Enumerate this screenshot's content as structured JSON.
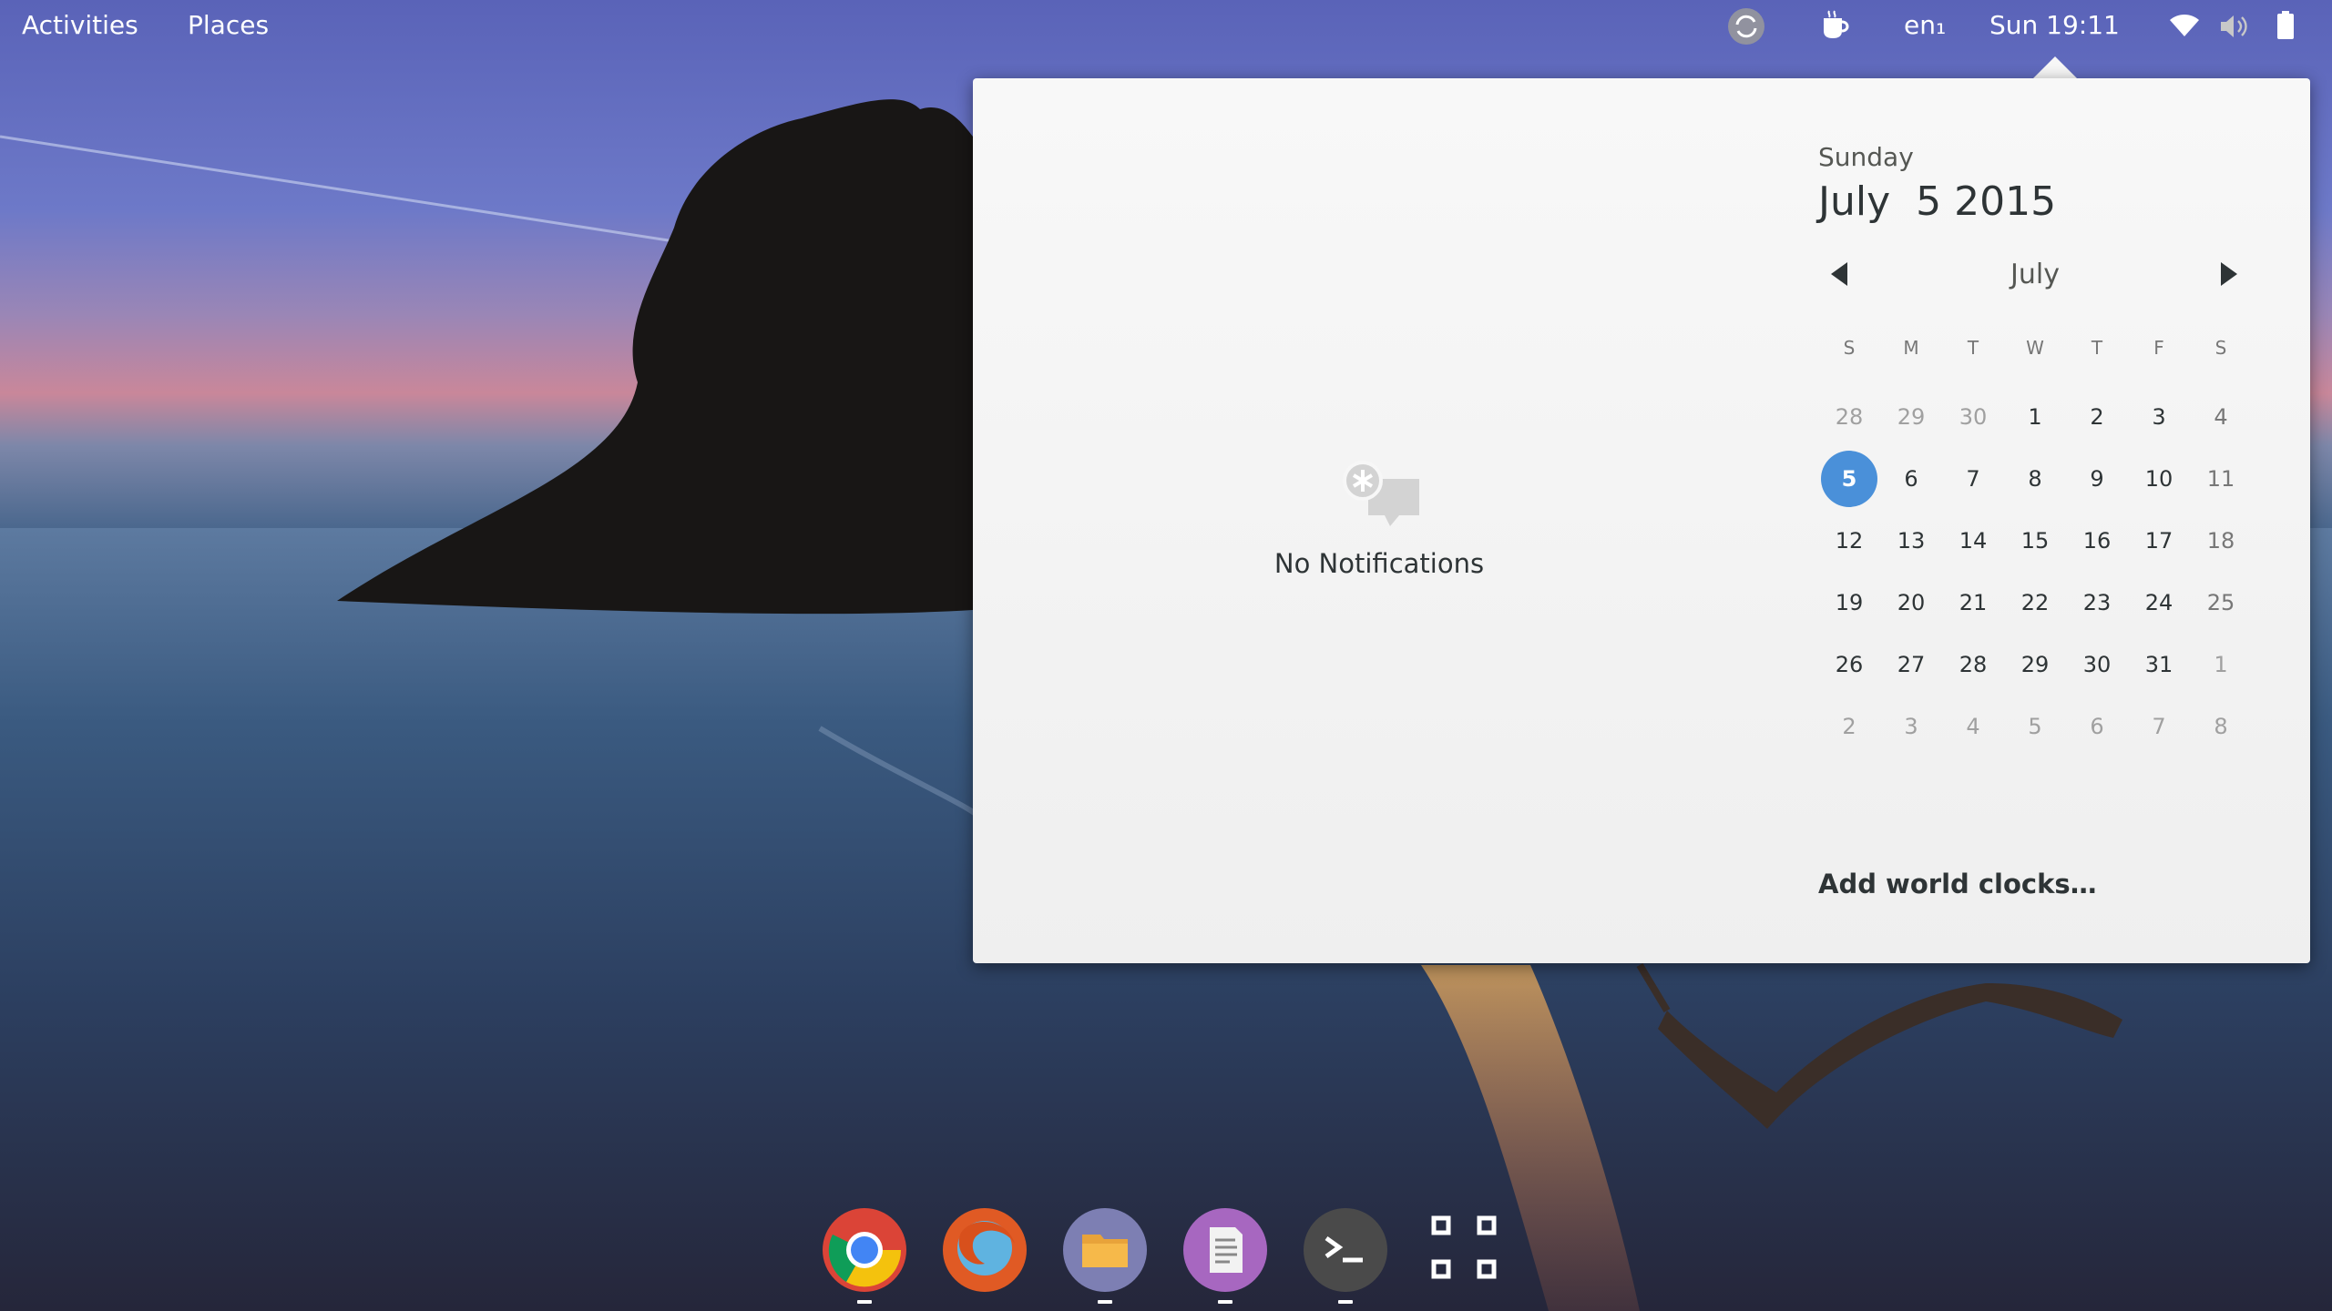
{
  "topbar": {
    "activities": "Activities",
    "places": "Places",
    "keyboard": "en₁",
    "clock": "Sun 19:11"
  },
  "popup": {
    "no_notifications": "No Notifications",
    "calendar": {
      "day_name": "Sunday",
      "date": "July  5 2015",
      "month": "July",
      "weekdays": [
        "S",
        "M",
        "T",
        "W",
        "T",
        "F",
        "S"
      ],
      "weeks": [
        [
          "28",
          "29",
          "30",
          "1",
          "2",
          "3",
          "4"
        ],
        [
          "5",
          "6",
          "7",
          "8",
          "9",
          "10",
          "11"
        ],
        [
          "12",
          "13",
          "14",
          "15",
          "16",
          "17",
          "18"
        ],
        [
          "19",
          "20",
          "21",
          "22",
          "23",
          "24",
          "25"
        ],
        [
          "26",
          "27",
          "28",
          "29",
          "30",
          "31",
          "1"
        ],
        [
          "2",
          "3",
          "4",
          "5",
          "6",
          "7",
          "8"
        ]
      ],
      "today": "5",
      "world_clocks": "Add world clocks…"
    }
  },
  "dock": {
    "apps": [
      "chrome-icon",
      "firefox-icon",
      "files-icon",
      "text-editor-icon",
      "terminal-icon",
      "app-grid-icon"
    ]
  },
  "colors": {
    "accent": "#4a90d9",
    "popup_bg": "#f7f7f7"
  }
}
